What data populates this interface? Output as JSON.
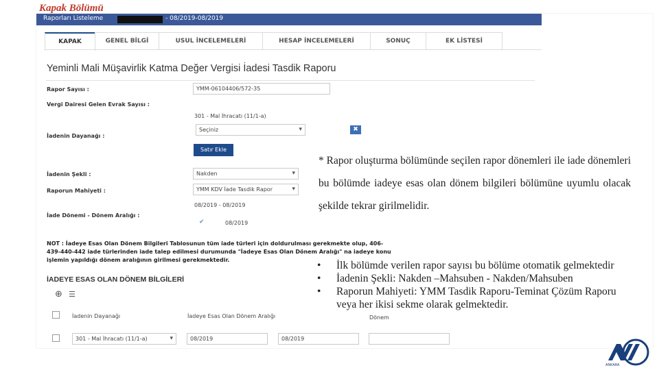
{
  "slide": {
    "title": "Kapak Bölümü"
  },
  "app": {
    "breadcrumb": "Raporları Listeleme",
    "period_header": "- 08/2019-08/2019",
    "tabs": [
      "KAPAK",
      "GENEL BİLGİ",
      "USUL İNCELEMELERİ",
      "HESAP İNCELEMELERİ",
      "SONUÇ",
      "EK LİSTESİ"
    ],
    "active_tab": "KAPAK",
    "form_title": "Yeminli Mali Müşavirlik Katma Değer Vergisi İadesi Tasdik Raporu",
    "fields": {
      "rapor_sayisi_label": "Rapor Sayısı :",
      "rapor_sayisi_value": "YMM-06104406/572-35",
      "evrak_label": "Vergi Dairesi Gelen Evrak Sayısı :",
      "dayanak_label": "İadenin Dayanağı :",
      "dayanak_value": "301 - Mal İhracatı (11/1-a)",
      "dayanak_select": "Seçiniz",
      "satir_ekle": "Satır Ekle",
      "remove_icon": "close-icon",
      "sekli_label": "İadenin Şekli :",
      "sekli_value": "Nakden",
      "mahiyeti_label": "Raporun Mahiyeti :",
      "mahiyeti_value": "YMM KDV İade Tasdik Rapor",
      "donem_label": "İade Dönemi - Dönem Aralığı :",
      "donem_range": "08/2019 - 08/2019",
      "donem_checked": "08/2019"
    },
    "note_lines": [
      "NOT : İadeye Esas Olan Dönem Bilgileri Tablosunun tüm iade türleri için doldurulması gerekmekte olup, 406-",
      "439-440-442 iade türlerinden iade talep edilmesi durumunda \"İadeye Esas Olan Dönem Aralığı\" na iadeye konu",
      "işlemin yapıldığı dönem aralığının girilmesi gerekmektedir."
    ],
    "section_title": "İADEYE ESAS OLAN DÖNEM BİLGİLERİ",
    "table": {
      "headers": [
        "İadenin Dayanağı",
        "İadeye Esas Olan Dönem Aralığı",
        "Dönem"
      ],
      "row": {
        "dayanak": "301 - Mal İhracatı (11/1-a)",
        "start": "08/2019",
        "end": "08/2019",
        "donem": ""
      }
    }
  },
  "overlay": {
    "paragraph": "* Rapor oluşturma bölümünde seçilen rapor dönemleri ile iade dönemleri bu bölümde iadeye esas olan dönem bilgileri bölümüne uyumlu olacak şekilde tekrar girilmelidir.",
    "bullets": [
      "İlk bölümde verilen rapor sayısı bu bölüme otomatik gelmektedir",
      "İadenin Şekli: Nakden –Mahsuben - Nakden/Mahsuben",
      "Raporun Mahiyeti: YMM Tasdik Raporu-Teminat Çözüm Raporu veya her ikisi sekme olarak gelmektedir."
    ],
    "bullet_char": "•"
  },
  "logo": {
    "text": "ANKARA",
    "color": "#1a3f7a"
  }
}
